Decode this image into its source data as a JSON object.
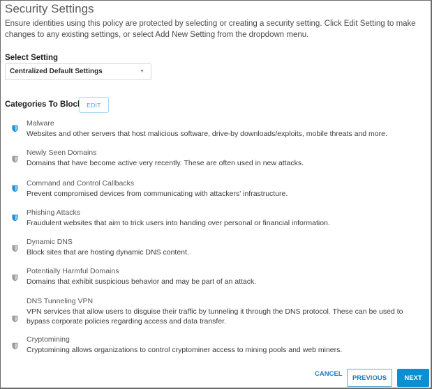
{
  "page": {
    "title": "Security Settings",
    "intro": "Ensure identities using this policy are protected by selecting or creating a security setting. Click Edit Setting to make changes to any existing settings, or select Add New Setting from the dropdown menu."
  },
  "select_setting": {
    "label": "Select Setting",
    "value": "Centralized Default Settings",
    "caret_icon": "caret-down-icon"
  },
  "categories": {
    "label": "Categories To Block",
    "edit_label": "EDIT",
    "active_color": "#1a8fd3",
    "inactive_color": "#9a9a9a",
    "items": [
      {
        "name": "Malware",
        "description": "Websites and other servers that host malicious software, drive-by downloads/exploits, mobile threats and more.",
        "enabled": true,
        "icon": "shield-icon"
      },
      {
        "name": "Newly Seen Domains",
        "description": "Domains that have become active very recently. These are often used in new attacks.",
        "enabled": false,
        "icon": "shield-icon"
      },
      {
        "name": "Command and Control Callbacks",
        "description": "Prevent compromised devices from communicating with attackers' infrastructure.",
        "enabled": true,
        "icon": "shield-icon"
      },
      {
        "name": "Phishing Attacks",
        "description": "Fraudulent websites that aim to trick users into handing over personal or financial information.",
        "enabled": true,
        "icon": "shield-icon"
      },
      {
        "name": "Dynamic DNS",
        "description": "Block sites that are hosting dynamic DNS content.",
        "enabled": false,
        "icon": "shield-icon"
      },
      {
        "name": "Potentially Harmful Domains",
        "description": "Domains that exhibit suspicious behavior and may be part of an attack.",
        "enabled": false,
        "icon": "shield-icon"
      },
      {
        "name": "DNS Tunneling VPN",
        "description": "VPN services that allow users to disguise their traffic by tunneling it through the DNS protocol. These can be used to bypass corporate policies regarding access and data transfer.",
        "enabled": false,
        "icon": "shield-icon"
      },
      {
        "name": "Cryptomining",
        "description": "Cryptomining allows organizations to control cryptominer access to mining pools and web miners.",
        "enabled": false,
        "icon": "shield-icon"
      }
    ]
  },
  "footer": {
    "cancel_label": "CANCEL",
    "previous_label": "PREVIOUS",
    "next_label": "NEXT"
  }
}
